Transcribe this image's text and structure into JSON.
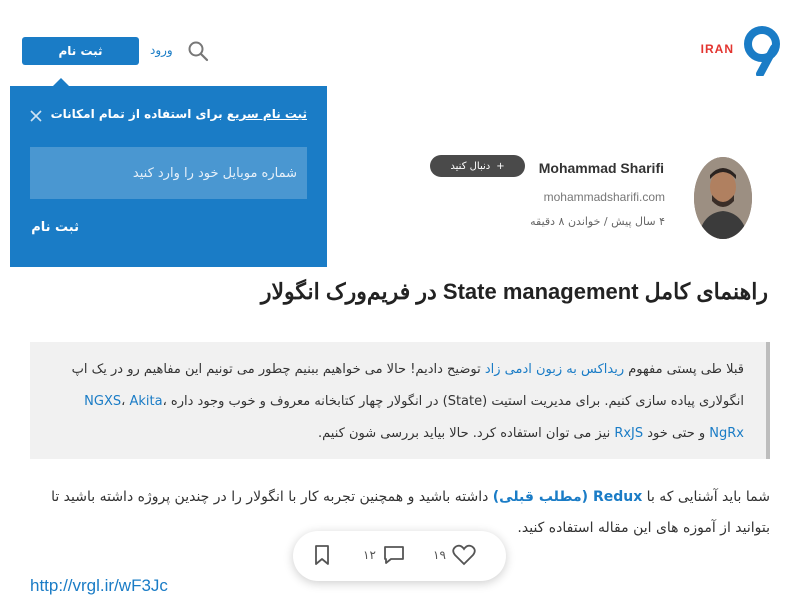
{
  "header": {
    "logo_text": "IRAN",
    "signup_label": "ثبت نام",
    "login_label": "ورود"
  },
  "popup": {
    "title_highlight": "ثبت نام سریع",
    "title_rest": " برای استفاده از تمام امکانات",
    "input_placeholder": "شماره موبایل خود را وارد کنید",
    "submit_label": "ثبت نام"
  },
  "author": {
    "name": "Mohammad Sharifi",
    "follow_label": "دنبال کنید",
    "website": "mohammadsharifi.com",
    "meta": "۴ سال پیش / خواندن ۸ دقیقه"
  },
  "post": {
    "title": "راهنمای کامل State management در فریم‌ورک انگولار",
    "quote": {
      "part1": "قبلا طی پستی مفهوم ",
      "link1": "ریداکس به زبون ادمی زاد",
      "part2": " توضیح دادیم! حالا می خواهیم ببنیم چطور می تونیم این مفاهیم رو در یک اپ انگولاری پیاده سازی کنیم. برای مدیریت استیت (State) در انگولار چهار کتابخانه معروف و خوب وجود داره ",
      "link2": "NGXS",
      "sep1": "، ",
      "link3": "Akita",
      "sep2": "، ",
      "link4": "NgRx",
      "part3": " و حتی خود ",
      "link5": "RxJS",
      "part4": " نیز می توان استفاده کرد. حالا بیاید بررسی شون کنیم."
    },
    "body": {
      "part1": "شما باید آشنایی که با ",
      "link1": "Redux (مطلب قبلی)",
      "part2": " داشته باشید و همچنین تجربه کار با انگولار را در چندین پروژه داشته باشید تا بتوانید از آموزه های این مقاله استفاده کنید."
    }
  },
  "actions": {
    "likes": "۱۹",
    "comments": "۱۲"
  },
  "short_url": "http://vrgl.ir/wF3Jc",
  "colors": {
    "accent": "#1a7cc6",
    "logo_red": "#e3342f"
  }
}
